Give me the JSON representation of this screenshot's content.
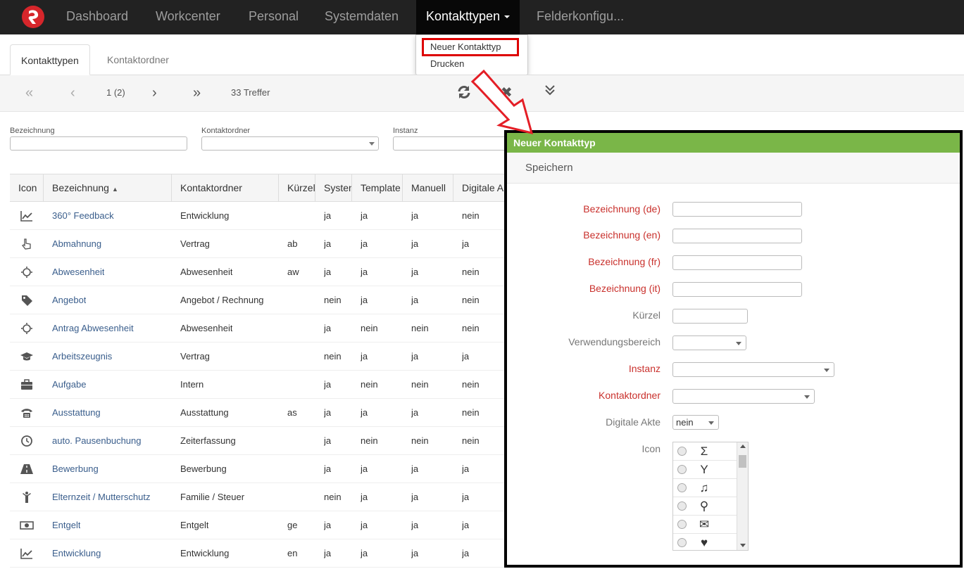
{
  "nav": {
    "items": [
      "Dashboard",
      "Workcenter",
      "Personal",
      "Systemdaten"
    ],
    "active": "Kontakttypen",
    "more": "Felderkonfigu..."
  },
  "dropdown": {
    "items": [
      "Neuer Kontakttyp",
      "Drucken"
    ]
  },
  "tabs": [
    "Kontakttypen",
    "Kontaktordner"
  ],
  "pager": {
    "page": "1 (2)",
    "hits": "33 Treffer"
  },
  "filters": {
    "labels": [
      "Bezeichnung",
      "Kontaktordner",
      "Instanz"
    ]
  },
  "grid": {
    "headers": [
      "Icon",
      "Bezeichnung",
      "Kontaktordner",
      "Kürzel",
      "Systen",
      "Template",
      "Manuell",
      "Digitale A"
    ],
    "rows": [
      {
        "icon": "chart-line-icon",
        "name": "360° Feedback",
        "folder": "Entwicklung",
        "short": "",
        "sys": "ja",
        "tpl": "ja",
        "man": "ja",
        "dig": "nein"
      },
      {
        "icon": "hand-pointer-icon",
        "name": "Abmahnung",
        "folder": "Vertrag",
        "short": "ab",
        "sys": "ja",
        "tpl": "ja",
        "man": "ja",
        "dig": "ja"
      },
      {
        "icon": "sun-icon",
        "name": "Abwesenheit",
        "folder": "Abwesenheit",
        "short": "aw",
        "sys": "ja",
        "tpl": "ja",
        "man": "ja",
        "dig": "nein"
      },
      {
        "icon": "tag-icon",
        "name": "Angebot",
        "folder": "Angebot / Rechnung",
        "short": "",
        "sys": "nein",
        "tpl": "ja",
        "man": "ja",
        "dig": "nein"
      },
      {
        "icon": "sun-icon",
        "name": "Antrag Abwesenheit",
        "folder": "Abwesenheit",
        "short": "",
        "sys": "ja",
        "tpl": "nein",
        "man": "nein",
        "dig": "nein"
      },
      {
        "icon": "graduation-cap-icon",
        "name": "Arbeitszeugnis",
        "folder": "Vertrag",
        "short": "",
        "sys": "nein",
        "tpl": "ja",
        "man": "ja",
        "dig": "ja"
      },
      {
        "icon": "briefcase-icon",
        "name": "Aufgabe",
        "folder": "Intern",
        "short": "",
        "sys": "ja",
        "tpl": "nein",
        "man": "nein",
        "dig": "nein"
      },
      {
        "icon": "phone-icon",
        "name": "Ausstattung",
        "folder": "Ausstattung",
        "short": "as",
        "sys": "ja",
        "tpl": "ja",
        "man": "ja",
        "dig": "nein"
      },
      {
        "icon": "clock-icon",
        "name": "auto. Pausenbuchung",
        "folder": "Zeiterfassung",
        "short": "",
        "sys": "ja",
        "tpl": "nein",
        "man": "nein",
        "dig": "nein"
      },
      {
        "icon": "road-icon",
        "name": "Bewerbung",
        "folder": "Bewerbung",
        "short": "",
        "sys": "ja",
        "tpl": "ja",
        "man": "ja",
        "dig": "ja"
      },
      {
        "icon": "child-icon",
        "name": "Elternzeit / Mutterschutz",
        "folder": "Familie / Steuer",
        "short": "",
        "sys": "nein",
        "tpl": "ja",
        "man": "ja",
        "dig": "ja"
      },
      {
        "icon": "money-icon",
        "name": "Entgelt",
        "folder": "Entgelt",
        "short": "ge",
        "sys": "ja",
        "tpl": "ja",
        "man": "ja",
        "dig": "ja"
      },
      {
        "icon": "chart-line-icon",
        "name": "Entwicklung",
        "folder": "Entwicklung",
        "short": "en",
        "sys": "ja",
        "tpl": "ja",
        "man": "ja",
        "dig": "ja"
      }
    ]
  },
  "panel": {
    "title": "Neuer Kontakttyp",
    "save": "Speichern",
    "fields": {
      "bez_de": "Bezeichnung (de)",
      "bez_en": "Bezeichnung (en)",
      "bez_fr": "Bezeichnung (fr)",
      "bez_it": "Bezeichnung (it)",
      "kuerzel": "Kürzel",
      "verwendung": "Verwendungsbereich",
      "instanz": "Instanz",
      "kontaktordner": "Kontaktordner",
      "digitale_akte": "Digitale Akte",
      "icon": "Icon"
    },
    "digitale_akte_value": "nein",
    "icons": [
      {
        "name": "sigma-icon",
        "glyph": "Σ"
      },
      {
        "name": "glass-icon",
        "glyph": "Y"
      },
      {
        "name": "music-icon",
        "glyph": "♫"
      },
      {
        "name": "search-icon",
        "glyph": "⚲"
      },
      {
        "name": "envelope-icon",
        "glyph": "✉"
      },
      {
        "name": "heart-icon",
        "glyph": "♥"
      }
    ]
  },
  "colors": {
    "accent_green": "#7ab648",
    "required_red": "#c9302c",
    "link_blue": "#3a5e8c",
    "nav_bg": "#222222"
  }
}
